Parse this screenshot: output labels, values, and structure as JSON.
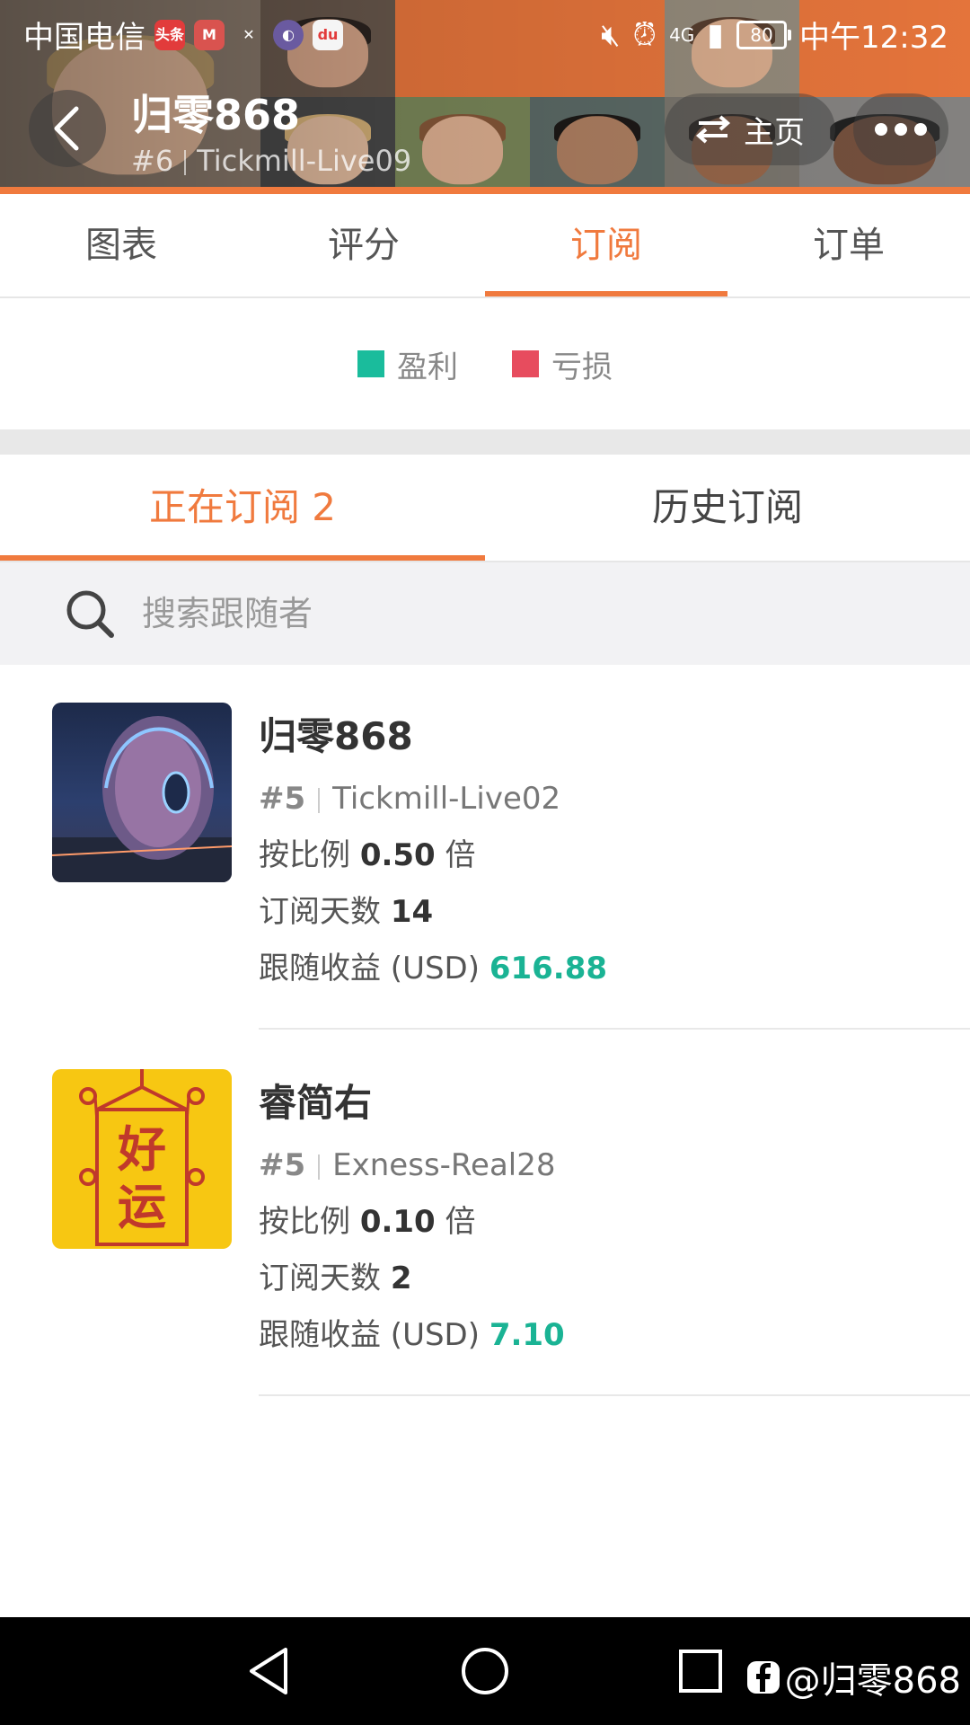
{
  "status_bar": {
    "carrier": "中国电信",
    "network": "4G",
    "battery": "80",
    "time": "中午12:32"
  },
  "header": {
    "name": "归零868",
    "rank": "#6",
    "server": "Tickmill-Live09",
    "home_label": "主页"
  },
  "main_tabs": [
    {
      "label": "图表"
    },
    {
      "label": "评分"
    },
    {
      "label": "订阅"
    },
    {
      "label": "订单"
    }
  ],
  "legend": [
    {
      "label": "盈利",
      "color": "#1abc9c"
    },
    {
      "label": "亏损",
      "color": "#e74c5e"
    }
  ],
  "sub_tabs": {
    "current": "正在订阅 2",
    "history": "历史订阅"
  },
  "search": {
    "placeholder": "搜索跟随者"
  },
  "subscriptions": [
    {
      "name": "归零868",
      "rank": "#5",
      "server": "Tickmill-Live02",
      "ratio_label": "按比例",
      "ratio_value": "0.50",
      "ratio_unit": "倍",
      "days_label": "订阅天数",
      "days_value": "14",
      "profit_label": "跟随收益 (USD)",
      "profit_value": "616.88"
    },
    {
      "name": "睿简右",
      "rank": "#5",
      "server": "Exness-Real28",
      "ratio_label": "按比例",
      "ratio_value": "0.10",
      "ratio_unit": "倍",
      "days_label": "订阅天数",
      "days_value": "2",
      "profit_label": "跟随收益 (USD)",
      "profit_value": "7.10",
      "thumb_text": "好运"
    }
  ],
  "watermark": "@归零868",
  "colors": {
    "accent": "#f07a3e",
    "profit": "#1ab394"
  }
}
